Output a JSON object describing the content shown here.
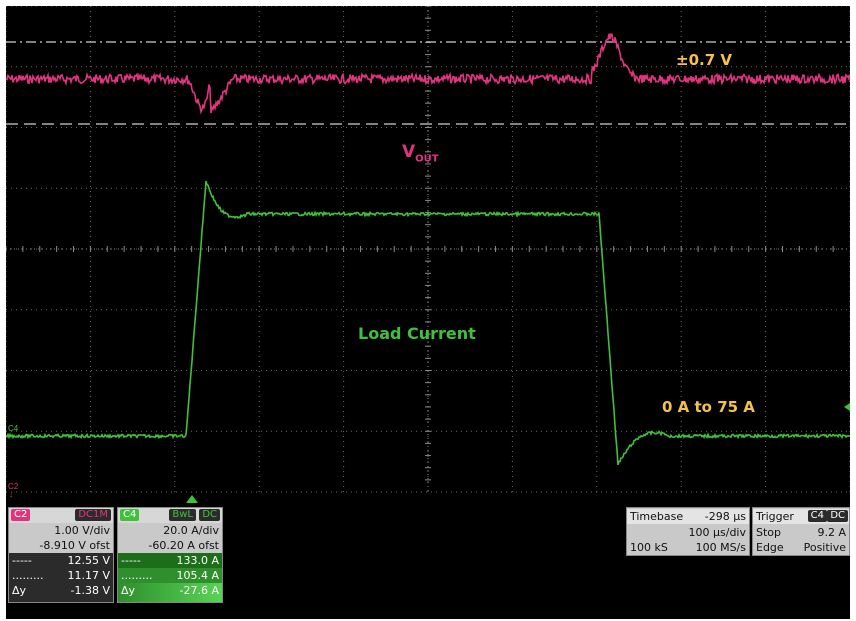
{
  "annotations": {
    "vout_main": "V",
    "vout_sub": "OUT",
    "ripple": "±0.7 V",
    "load_current": "Load Current",
    "step": "0 A to 75 A"
  },
  "markers": {
    "c4": "C4",
    "c2": "C2"
  },
  "colors": {
    "ch2": "#e0357e",
    "ch4": "#3fc23a",
    "annotation": "#f6c24a",
    "grid": "#7a7a7a"
  },
  "ch2": {
    "label": "C2",
    "coupling": "DC1M",
    "scale": "1.00 V/div",
    "offset": "-8.910 V ofst",
    "cursor1_mark": "-----",
    "cursor1": "12.55 V",
    "cursor2_mark": ".........",
    "cursor2": "11.17 V",
    "delta_label": "Δy",
    "delta": "-1.38 V"
  },
  "ch4": {
    "label": "C4",
    "bw": "BwL",
    "coupling": "DC",
    "scale": "20.0 A/div",
    "offset": "-60.20 A ofst",
    "cursor1_mark": "-----",
    "cursor1": "133.0 A",
    "cursor2_mark": ".........",
    "cursor2": "105.4 A",
    "delta_label": "Δy",
    "delta": "-27.6 A"
  },
  "timebase": {
    "label": "Timebase",
    "delay": "-298 µs",
    "scale": "100 µs/div",
    "samples": "100 kS",
    "rate": "100 MS/s"
  },
  "trigger": {
    "label": "Trigger",
    "source": "C4",
    "coupling": "DC",
    "mode": "Stop",
    "level": "9.2 A",
    "type": "Edge",
    "slope": "Positive"
  }
}
